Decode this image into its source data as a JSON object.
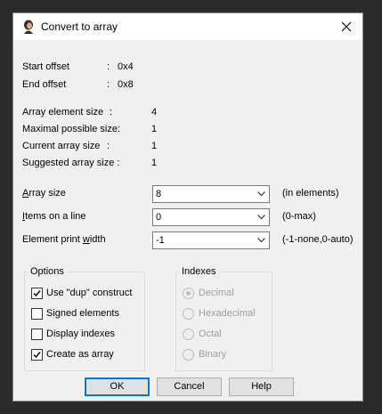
{
  "window": {
    "title": "Convert to array",
    "title_icon": "ida-icon",
    "close_icon": "close-icon"
  },
  "info": {
    "start_offset_label": "Start offset",
    "start_offset_value": "0x4",
    "end_offset_label": "End offset",
    "end_offset_value": "0x8",
    "array_element_size_label": "Array element size",
    "array_element_size_value": "4",
    "maximal_possible_size_label": "Maximal possible size:",
    "maximal_possible_size_value": "1",
    "current_array_size_label": "Current array size",
    "current_array_size_value": "1",
    "suggested_array_size_label": "Suggested array size :",
    "suggested_array_size_value": "1",
    "colon": ":"
  },
  "fields": {
    "array_size": {
      "label_u": "A",
      "label_rest": "rray size",
      "value": "8",
      "hint": "(in elements)"
    },
    "items_on_line": {
      "label_u": "I",
      "label_rest": "tems on a line",
      "value": "0",
      "hint": "(0-max)"
    },
    "element_print_width": {
      "label_pre": "Element print ",
      "label_u": "w",
      "label_rest": "idth",
      "value": "-1",
      "hint": "(-1-none,0-auto)"
    }
  },
  "options": {
    "title": "Options",
    "use_dup": {
      "label": "Use \"dup\" construct",
      "checked": true
    },
    "signed_elements": {
      "label": "Signed elements",
      "checked": false
    },
    "display_indexes": {
      "label": "Display indexes",
      "checked": false
    },
    "create_as_array": {
      "label": "Create as array",
      "checked": true
    }
  },
  "indexes": {
    "title": "Indexes",
    "items": [
      "Decimal",
      "Hexadecimal",
      "Octal",
      "Binary"
    ],
    "selected": "Decimal",
    "disabled": true
  },
  "buttons": {
    "ok": "OK",
    "cancel": "Cancel",
    "help": "Help"
  },
  "colors": {
    "default_button_border": "#0078d7",
    "dialog_background": "#f0f0f0"
  }
}
